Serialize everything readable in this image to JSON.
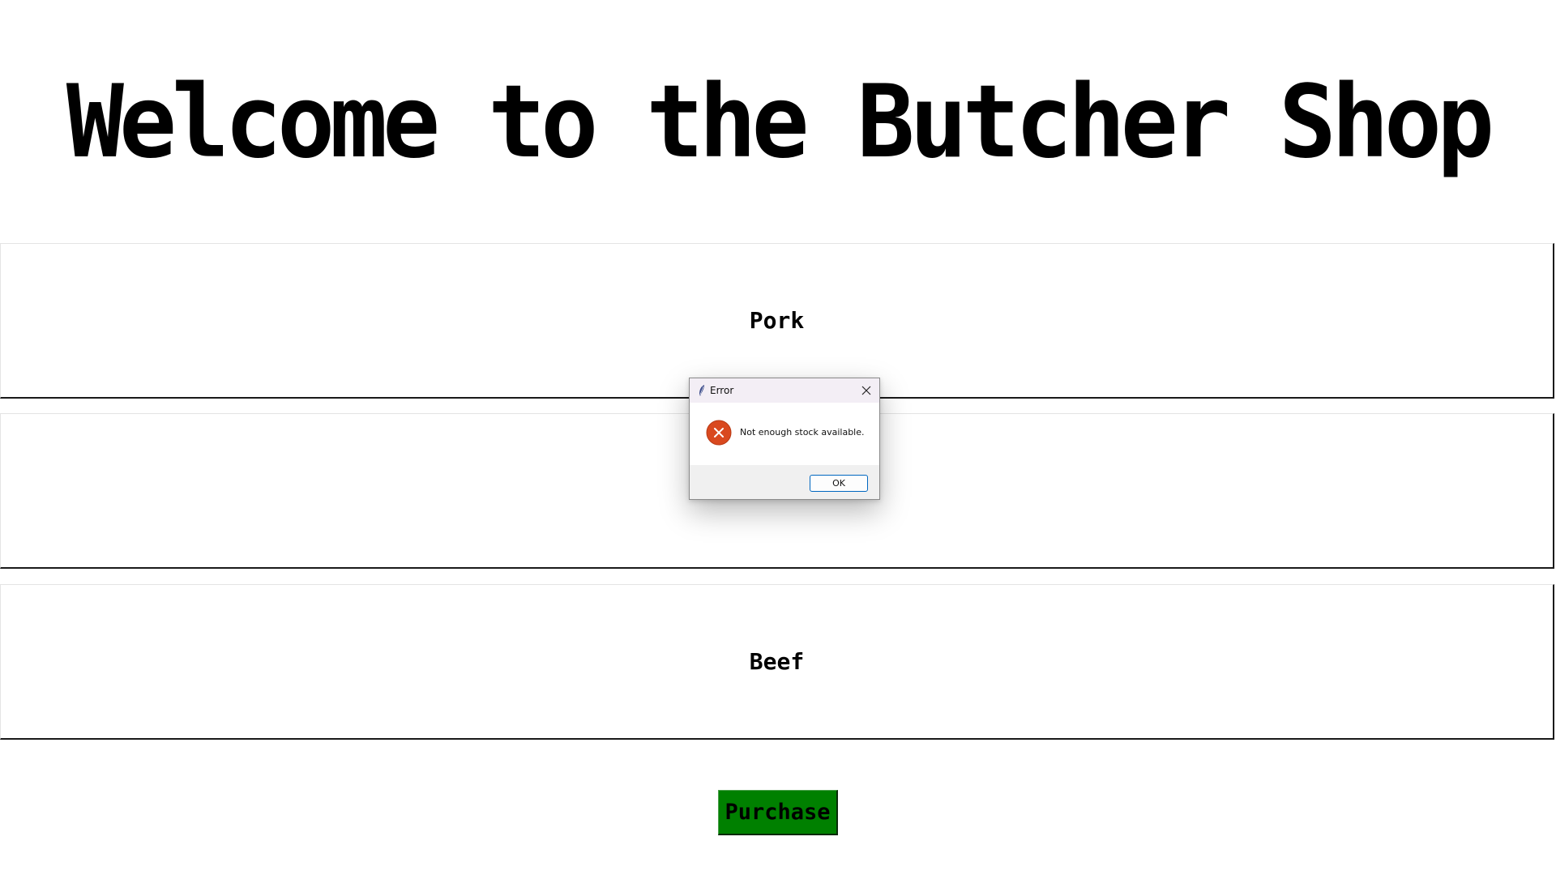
{
  "page": {
    "title": "Welcome to the Butcher Shop"
  },
  "products": {
    "pork_label": "Pork",
    "middle_label": "",
    "beef_label": "Beef"
  },
  "purchase": {
    "label": "Purchase",
    "color": "#008000"
  },
  "dialog": {
    "title": "Error",
    "message": "Not enough stock available.",
    "ok_label": "OK",
    "icon": "error-icon",
    "icon_color": "#e0502a",
    "app_icon": "feather-icon",
    "close_icon": "close-icon"
  }
}
